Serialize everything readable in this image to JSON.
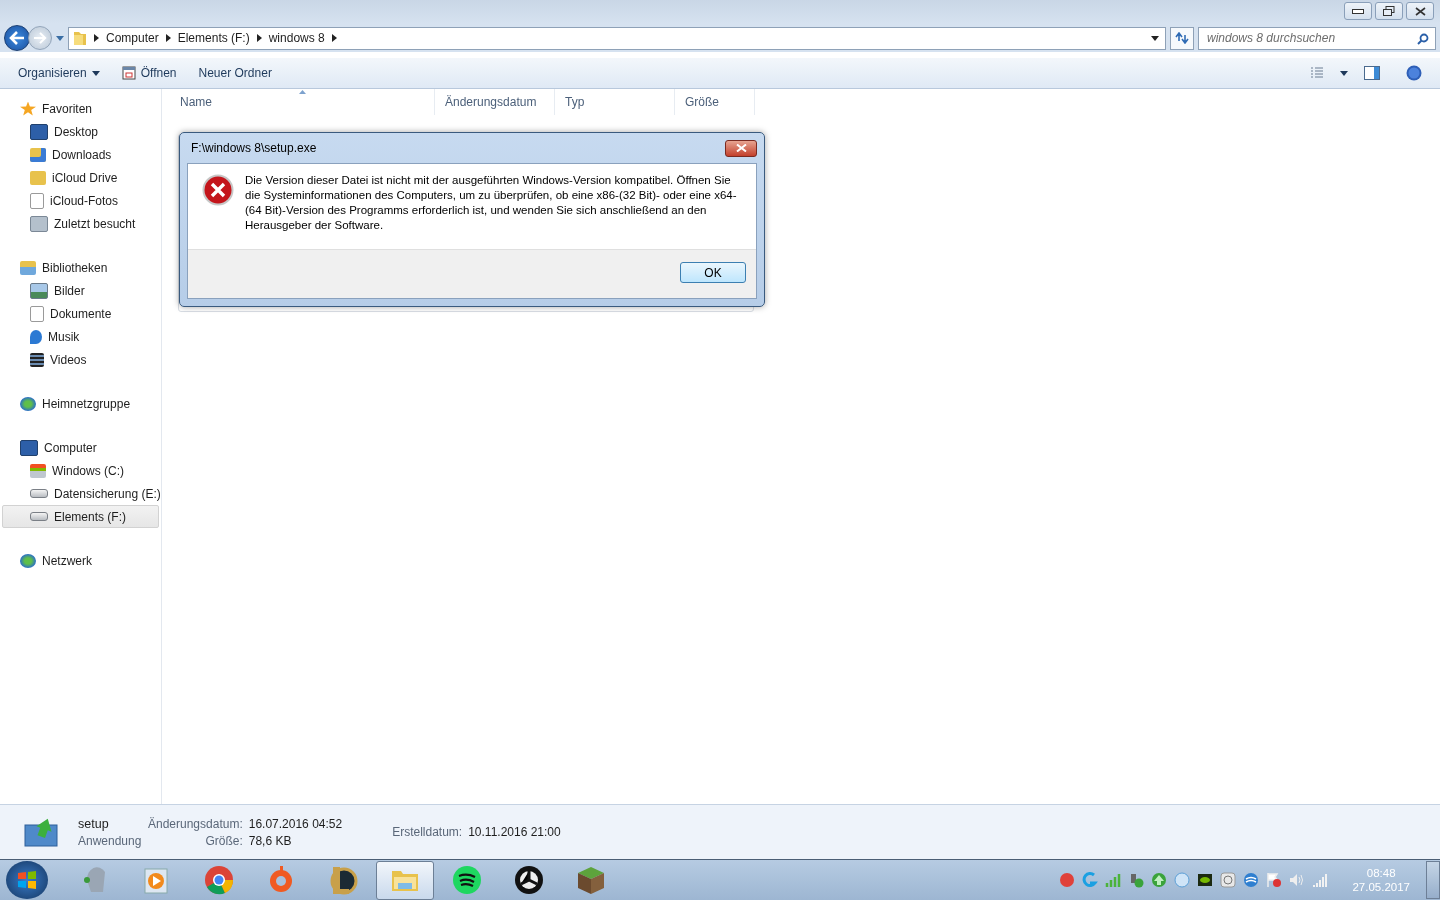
{
  "address": {
    "crumbs": [
      "Computer",
      "Elements (F:)",
      "windows 8"
    ]
  },
  "search": {
    "placeholder": "windows 8 durchsuchen"
  },
  "toolbar": [
    {
      "label": "Organisieren",
      "kind": "menu"
    },
    {
      "label": "Öffnen",
      "kind": "open"
    },
    {
      "label": "Neuer Ordner",
      "kind": "plain"
    }
  ],
  "columns": [
    {
      "label": "Name",
      "sorted": true
    },
    {
      "label": "Änderungsdatum",
      "sorted": false
    },
    {
      "label": "Typ",
      "sorted": false
    },
    {
      "label": "Größe",
      "sorted": false
    }
  ],
  "sidebar": [
    {
      "label": "Favoriten",
      "kind": "star",
      "selected": false,
      "children": [
        {
          "label": "Desktop",
          "kind": "desktop",
          "selected": false
        },
        {
          "label": "Downloads",
          "kind": "downloads",
          "selected": false
        },
        {
          "label": "iCloud Drive",
          "kind": "folder",
          "selected": false
        },
        {
          "label": "iCloud-Fotos",
          "kind": "file",
          "selected": false
        },
        {
          "label": "Zuletzt besucht",
          "kind": "recent",
          "selected": false
        }
      ]
    },
    {
      "label": "Bibliotheken",
      "kind": "library",
      "selected": false,
      "children": [
        {
          "label": "Bilder",
          "kind": "pictures",
          "selected": false
        },
        {
          "label": "Dokumente",
          "kind": "document",
          "selected": false
        },
        {
          "label": "Musik",
          "kind": "music",
          "selected": false
        },
        {
          "label": "Videos",
          "kind": "video",
          "selected": false
        }
      ]
    },
    {
      "label": "Heimnetzgruppe",
      "kind": "homegroup",
      "selected": false
    },
    {
      "label": "Computer",
      "kind": "computer",
      "selected": false,
      "children": [
        {
          "label": "Windows (C:)",
          "kind": "windrive",
          "selected": false
        },
        {
          "label": "Datensicherung (E:)",
          "kind": "drive",
          "selected": false
        },
        {
          "label": "Elements (F:)",
          "kind": "drive",
          "selected": true
        }
      ]
    },
    {
      "label": "Netzwerk",
      "kind": "network",
      "selected": false
    }
  ],
  "dialog": {
    "title": "F:\\windows 8\\setup.exe",
    "message": "Die Version dieser Datei ist nicht mit der ausgeführten Windows-Version kompatibel. Öffnen Sie die Systeminformationen des Computers, um zu überprüfen, ob eine x86-(32 Bit)- oder eine x64-(64 Bit)-Version des Programms erforderlich ist, und wenden Sie sich anschließend an den Herausgeber der Software.",
    "button": "OK"
  },
  "details": {
    "name": "setup",
    "type": "Anwendung",
    "fields": [
      {
        "label": "Änderungsdatum:",
        "value": "16.07.2016 04:52"
      },
      {
        "label": "Größe:",
        "value": "78,6 KB"
      },
      {
        "label": "Erstelldatum:",
        "value": "10.11.2016 21:00"
      }
    ]
  },
  "taskbar": {
    "apps": [
      {
        "kind": "headset",
        "active": false
      },
      {
        "kind": "player",
        "active": false
      },
      {
        "kind": "browser",
        "active": false
      },
      {
        "kind": "ring",
        "active": false
      },
      {
        "kind": "emblem",
        "active": false
      },
      {
        "kind": "explorer",
        "active": true
      },
      {
        "kind": "waves",
        "active": false
      },
      {
        "kind": "aperture",
        "active": false
      },
      {
        "kind": "block",
        "active": false
      }
    ]
  },
  "clock": {
    "time": "08:48",
    "date": "27.05.2017"
  }
}
